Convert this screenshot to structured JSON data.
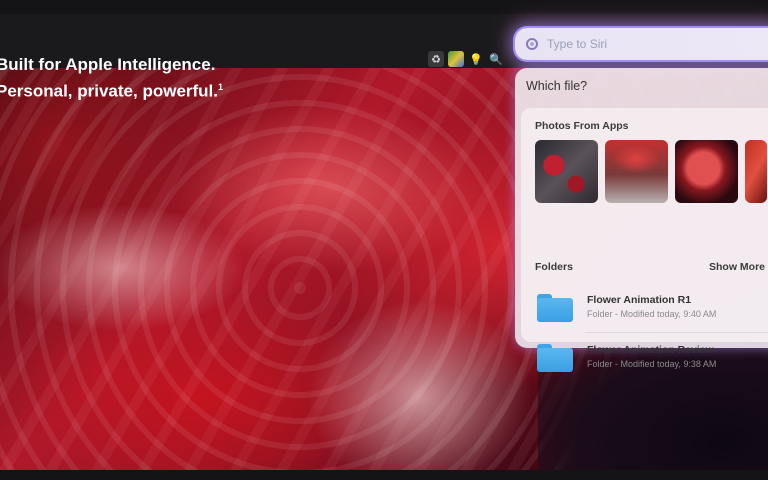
{
  "headline": {
    "line1": "Built for Apple Intelligence.",
    "line2": "Personal, private, powerful.",
    "footnote": "1"
  },
  "menubar": {
    "icons": [
      "recycle-icon",
      "map-icon",
      "lightbulb-icon",
      "magnifier-icon"
    ]
  },
  "siri": {
    "placeholder": "Type to Siri",
    "value": ""
  },
  "results": {
    "prompt": "Which file?",
    "photos_label": "Photos From Apps",
    "photos": [
      {
        "name": "photo-1"
      },
      {
        "name": "photo-2"
      },
      {
        "name": "photo-3"
      },
      {
        "name": "photo-4"
      }
    ],
    "folders_label": "Folders",
    "show_more": "Show More",
    "folders": [
      {
        "name": "Flower Animation R1",
        "meta": "Folder - Modified today, 9:40 AM"
      },
      {
        "name": "Flower Animation Review",
        "meta": "Folder - Modified today, 9:38 AM"
      }
    ]
  },
  "colors": {
    "folder": "#3a9ee2",
    "siri_glow": "#aa96ff",
    "hero_red": "#b0182a"
  }
}
